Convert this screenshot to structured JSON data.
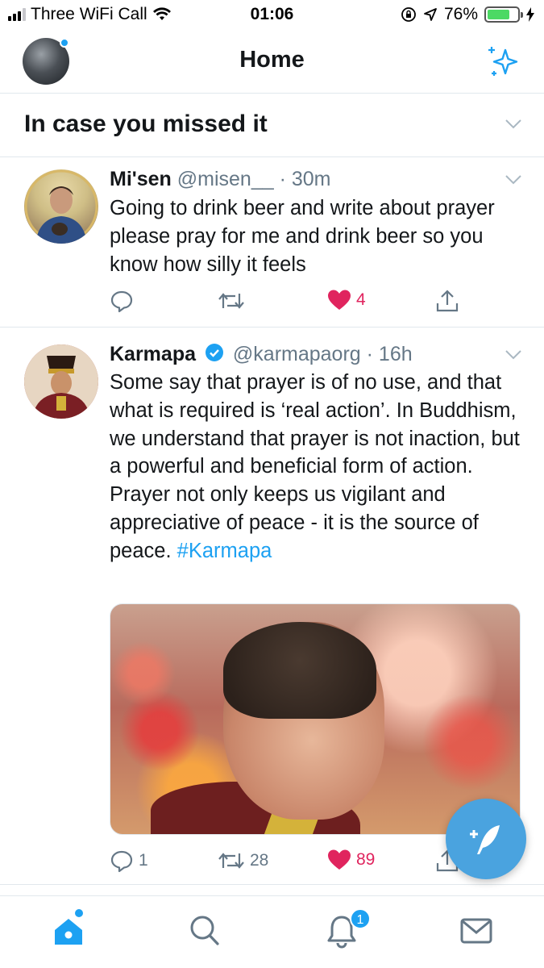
{
  "status_bar": {
    "carrier": "Three WiFi Call",
    "time": "01:06",
    "battery_percent": "76%",
    "battery_level": 0.76
  },
  "header": {
    "title": "Home",
    "accent_color": "#1da1f2"
  },
  "section": {
    "title": "In case you missed it"
  },
  "tweets": [
    {
      "name": "Mi'sen",
      "handle": "@misen__",
      "time": "· 30m",
      "text": "Going to drink beer and write about prayer please pray for me and drink beer so you know how silly it feels",
      "likes": "4"
    },
    {
      "name": "Karmapa",
      "handle": "@karmapaorg",
      "time": "· 16h",
      "text": "Some say that prayer is of no use, and that what is required is ‘real action’. In Buddhism, we understand that prayer is not inaction, but a powerful and beneficial form of action. Prayer not only keeps us vigilant and appreciative of peace - it is the source of peace.",
      "hashtag": "#Karmapa",
      "replies": "1",
      "retweets": "28",
      "likes": "89"
    }
  ],
  "tabbar": {
    "notification_badge": "1"
  },
  "colors": {
    "like": "#e0245e",
    "muted": "#657786",
    "divider": "#e1e8ed"
  }
}
